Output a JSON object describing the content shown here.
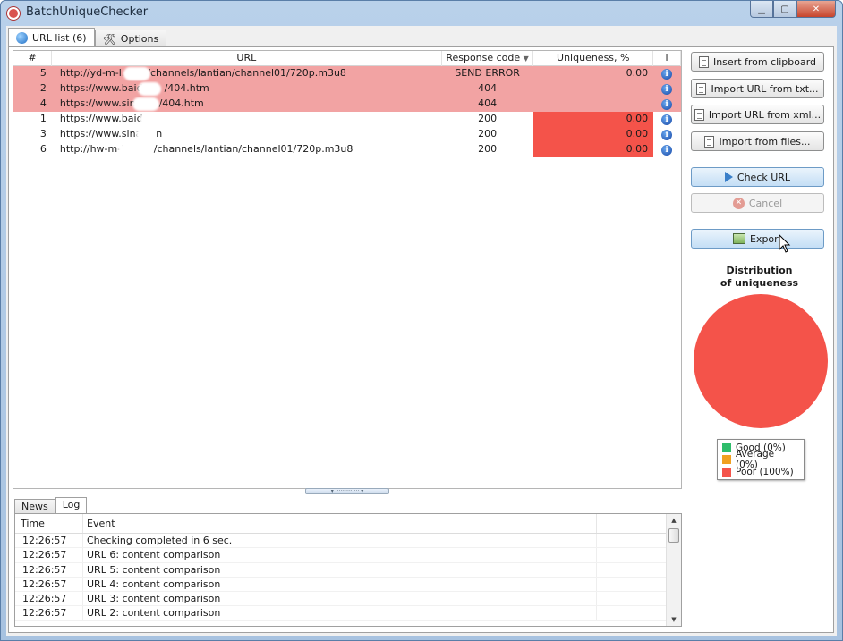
{
  "window": {
    "title": "BatchUniqueChecker",
    "controls": {
      "minimize": "▁",
      "maximize": "▢",
      "close": "✕"
    }
  },
  "tabs": [
    {
      "label": "URL list (6)",
      "icon": "globe-icon",
      "active": true
    },
    {
      "label": "Options",
      "icon": "tools-icon",
      "active": false
    }
  ],
  "url_grid": {
    "columns": [
      "#",
      "URL",
      "Response code",
      "Uniqueness, %",
      "i"
    ],
    "rows": [
      {
        "num": "5",
        "url_start": "http://yd-m-l.",
        "url_end": "/channels/lantian/channel01/720p.m3u8",
        "code": "SEND ERROR",
        "uniqueness": "0.00",
        "status": "error"
      },
      {
        "num": "2",
        "url_start": "https://www.baid",
        "url_end": "/404.htm",
        "code": "404",
        "uniqueness": "",
        "status": "error"
      },
      {
        "num": "4",
        "url_start": "https://www.sin",
        "url_end": "/404.htm",
        "code": "404",
        "uniqueness": "",
        "status": "error"
      },
      {
        "num": "1",
        "url_start": "https://www.baid",
        "url_end": "",
        "code": "200",
        "uniqueness": "0.00",
        "status": "poor"
      },
      {
        "num": "3",
        "url_start": "https://www.sina",
        "url_end": "n",
        "code": "200",
        "uniqueness": "0.00",
        "status": "poor"
      },
      {
        "num": "6",
        "url_start": "http://hw-m-l.",
        "url_end": "/channels/lantian/channel01/720p.m3u8",
        "code": "200",
        "uniqueness": "0.00",
        "status": "poor"
      }
    ]
  },
  "bottom_tabs": [
    {
      "label": "News",
      "active": false
    },
    {
      "label": "Log",
      "active": true
    }
  ],
  "log": {
    "columns": [
      "Time",
      "Event"
    ],
    "rows": [
      {
        "time": "12:26:57",
        "event": "Checking completed in 6 sec."
      },
      {
        "time": "12:26:57",
        "event": "URL 6: content comparison"
      },
      {
        "time": "12:26:57",
        "event": "URL 5: content comparison"
      },
      {
        "time": "12:26:57",
        "event": "URL 4: content comparison"
      },
      {
        "time": "12:26:57",
        "event": "URL 3: content comparison"
      },
      {
        "time": "12:26:57",
        "event": "URL 2: content comparison"
      }
    ]
  },
  "actions": {
    "insert_clipboard": "Insert from clipboard",
    "import_txt": "Import URL from txt...",
    "import_xml": "Import URL from xml...",
    "import_files": "Import from files...",
    "check_url": "Check URL",
    "cancel": "Cancel",
    "export": "Export"
  },
  "distribution": {
    "title_line1": "Distribution",
    "title_line2": "of uniqueness"
  },
  "chart_data": {
    "type": "pie",
    "title": "Distribution of uniqueness",
    "categories": [
      "Good",
      "Average",
      "Poor"
    ],
    "values": [
      0,
      0,
      100
    ],
    "legend_labels": [
      "Good (0%)",
      "Average (0%)",
      "Poor (100%)"
    ],
    "colors": [
      "#2ebd6b",
      "#f0a020",
      "#f4534a"
    ],
    "legend_position": "bottom"
  },
  "colors": {
    "error_row": "#f2a3a3",
    "poor_cell": "#f4534a",
    "accent_blue": "#3a7fc9"
  }
}
